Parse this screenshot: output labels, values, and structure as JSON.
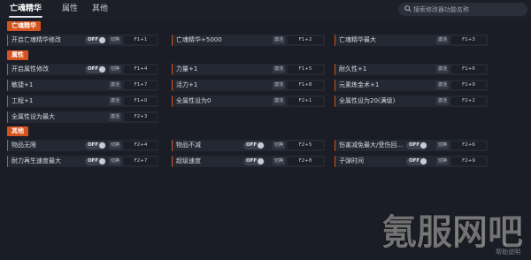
{
  "tabs": [
    {
      "label": "亡魂精华",
      "active": true
    },
    {
      "label": "属性",
      "active": false
    },
    {
      "label": "其他",
      "active": false
    }
  ],
  "search": {
    "placeholder": "搜索修改器功能名称"
  },
  "sections": [
    "亡魂精华",
    "属性",
    "其他"
  ],
  "rows": [
    {
      "label": "开启亡魂精华修改",
      "type": "toggle",
      "state": "OFF",
      "action": "切换",
      "key": "F1+1"
    },
    {
      "label": "亡魂精华+5000",
      "type": "button",
      "action": "激活",
      "key": "F1+2"
    },
    {
      "label": "亡魂精华最大",
      "type": "button",
      "action": "激活",
      "key": "F1+3"
    },
    {
      "label": "开启属性修改",
      "type": "toggle",
      "state": "OFF",
      "action": "切换",
      "key": "F1+4"
    },
    {
      "label": "力量+1",
      "type": "button",
      "action": "激活",
      "key": "F1+5"
    },
    {
      "label": "耐久性+1",
      "type": "button",
      "action": "激活",
      "key": "F1+6"
    },
    {
      "label": "敏捷+1",
      "type": "button",
      "action": "激活",
      "key": "F1+7"
    },
    {
      "label": "活力+1",
      "type": "button",
      "action": "激活",
      "key": "F1+8"
    },
    {
      "label": "元素炼金术+1",
      "type": "button",
      "action": "激活",
      "key": "F1+9"
    },
    {
      "label": "工程+1",
      "type": "button",
      "action": "激活",
      "key": "F1+0"
    },
    {
      "label": "全属性设为0",
      "type": "button",
      "action": "激活",
      "key": "F2+1"
    },
    {
      "label": "全属性设为20(满级)",
      "type": "button",
      "action": "激活",
      "key": "F2+2"
    },
    {
      "label": "全属性设为最大",
      "type": "button",
      "action": "激活",
      "key": "F2+3"
    },
    {
      "label": "物品无限",
      "type": "toggle",
      "state": "OFF",
      "action": "切换",
      "key": "F2+4"
    },
    {
      "label": "物品不减",
      "type": "toggle",
      "state": "OFF",
      "action": "切换",
      "key": "F2+5"
    },
    {
      "label": "伤害减免最大/受伤回…",
      "type": "toggle",
      "state": "OFF",
      "action": "切换",
      "key": "F2+6"
    },
    {
      "label": "耐力再生速度最大",
      "type": "toggle",
      "state": "OFF",
      "action": "切换",
      "key": "F2+7"
    },
    {
      "label": "超级速度",
      "type": "toggle",
      "state": "OFF",
      "action": "切换",
      "key": "F2+8"
    },
    {
      "label": "子弹时间",
      "type": "toggle",
      "state": "OFF",
      "action": "切换",
      "key": "F2+9"
    }
  ],
  "help": "帮助说明",
  "watermark": "氪服网吧",
  "colors": {
    "accent": "#d4531e",
    "bg": "#1a1d25",
    "row": "#242832"
  }
}
